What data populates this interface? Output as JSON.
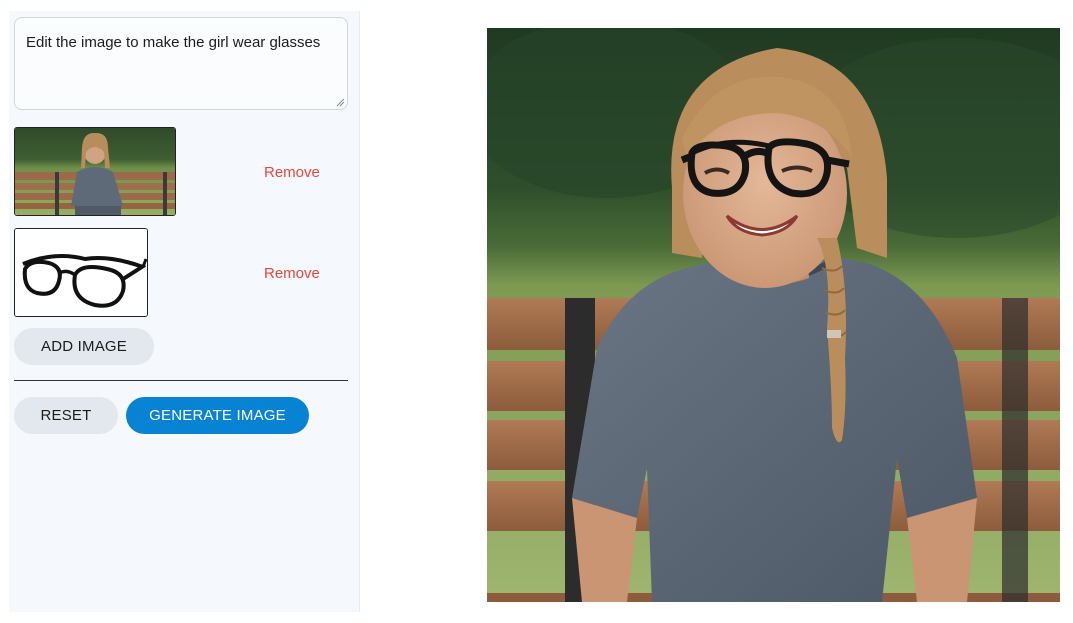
{
  "prompt": {
    "value": "Edit the image to make the girl wear glasses"
  },
  "images": [
    {
      "remove_label": "Remove"
    },
    {
      "remove_label": "Remove"
    }
  ],
  "buttons": {
    "add_image": "ADD IMAGE",
    "reset": "RESET",
    "generate": "GENERATE IMAGE"
  },
  "colors": {
    "accent": "#0883d3",
    "remove": "#e5483a",
    "panel": "#f5f8fc"
  }
}
